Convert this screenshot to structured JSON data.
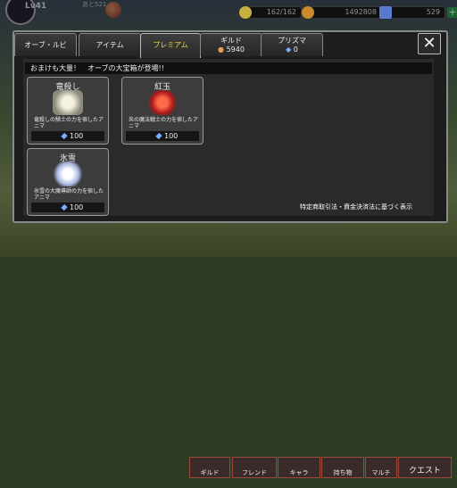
{
  "hud": {
    "level": "Lv41",
    "level_sub": "あと521",
    "stamina": "162/162",
    "gold": "1492808",
    "gems": "529",
    "plus": "+"
  },
  "tabs": [
    {
      "label": "オーブ・ルビ"
    },
    {
      "label": "アイテム"
    },
    {
      "label": "プレミアム"
    },
    {
      "label": "ギルド",
      "value": "5940"
    },
    {
      "label": "プリズマ",
      "value": "0"
    }
  ],
  "close_label": "✕",
  "banner": "おまけも大量！　オーブの大宝箱が登場!!",
  "items": [
    {
      "name": "竜殺し",
      "desc": "竜殺しの騎士の力を宿したアニマ",
      "price": "100",
      "color": "#e8e8e0"
    },
    {
      "name": "紅玉",
      "desc": "炎の魔法戦士の力を宿したアニマ",
      "price": "100",
      "color": "#e83a3a"
    },
    {
      "name": "氷雪",
      "desc": "氷雪の大魔導師の力を宿したアニマ",
      "price": "100",
      "color": "#dfe6f5"
    }
  ],
  "legal": "特定商取引法・資金決済法に基づく表示",
  "bottom_menu": [
    "ギルド",
    "フレンド",
    "キャラ",
    "持ち物",
    "マルチ",
    "クエスト"
  ]
}
